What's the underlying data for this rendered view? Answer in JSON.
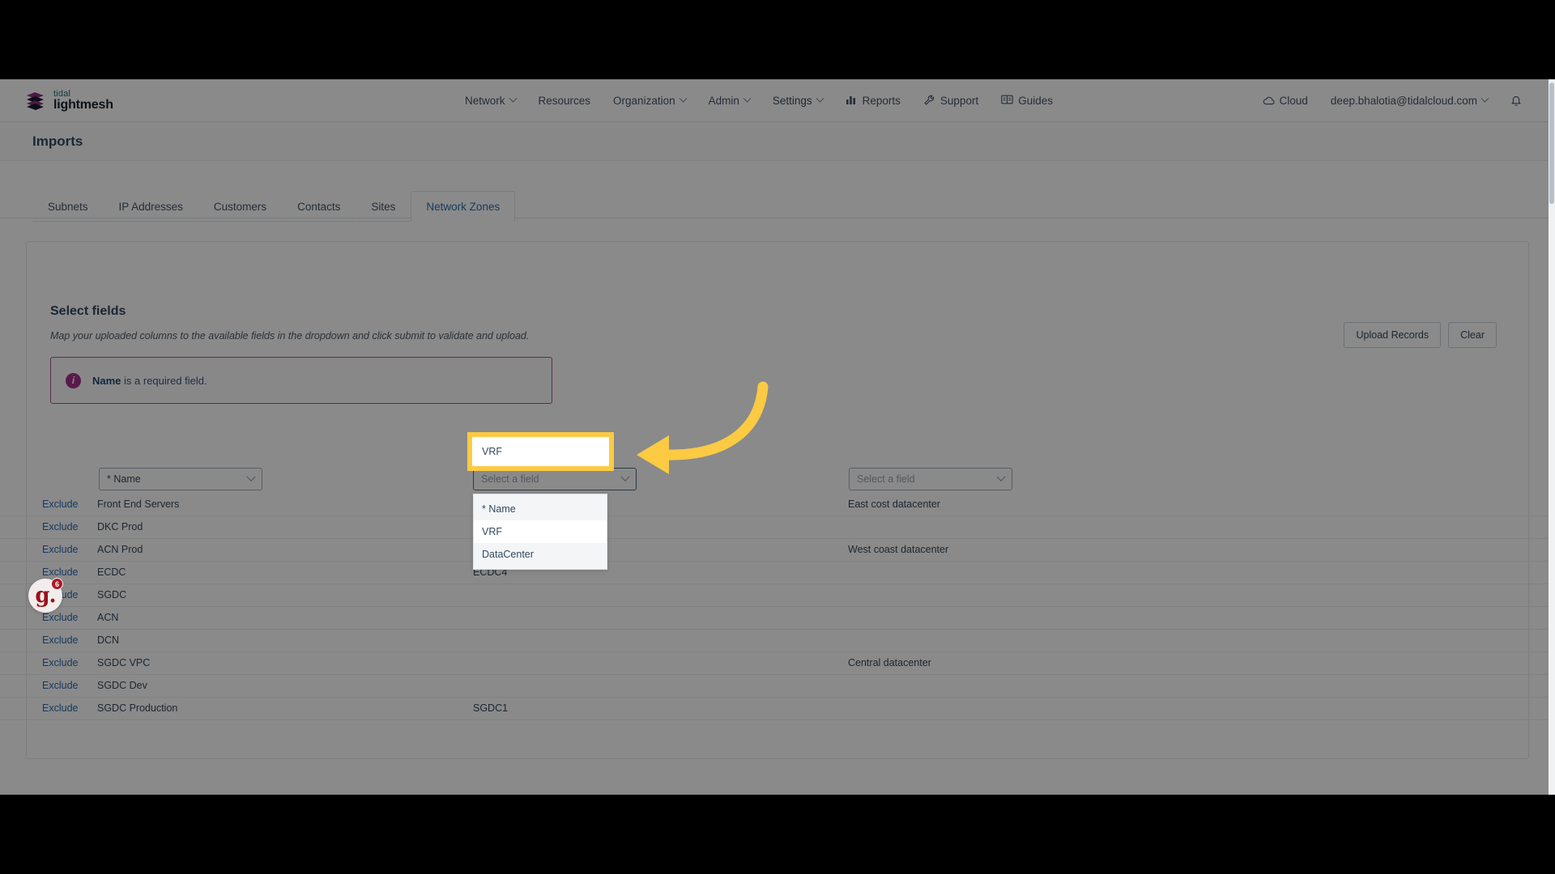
{
  "brand": {
    "line1": "tidal",
    "line2": "lightmesh"
  },
  "nav": {
    "items": [
      {
        "label": "Network",
        "caret": true,
        "icon": ""
      },
      {
        "label": "Resources",
        "caret": false,
        "icon": ""
      },
      {
        "label": "Organization",
        "caret": true,
        "icon": ""
      },
      {
        "label": "Admin",
        "caret": true,
        "icon": ""
      },
      {
        "label": "Settings",
        "caret": true,
        "icon": ""
      },
      {
        "label": "Reports",
        "caret": false,
        "icon": "chart-bar-icon"
      },
      {
        "label": "Support",
        "caret": false,
        "icon": "wrench-icon"
      },
      {
        "label": "Guides",
        "caret": false,
        "icon": "book-icon"
      }
    ],
    "right": {
      "cloud_label": "Cloud",
      "cloud_icon": "cloud-icon",
      "account_email": "deep.bhalotia@tidalcloud.com",
      "account_caret": true,
      "bell_icon": "bell-icon"
    }
  },
  "page": {
    "title": "Imports"
  },
  "tabs": [
    {
      "label": "Subnets",
      "active": false
    },
    {
      "label": "IP Addresses",
      "active": false
    },
    {
      "label": "Customers",
      "active": false
    },
    {
      "label": "Contacts",
      "active": false
    },
    {
      "label": "Sites",
      "active": false
    },
    {
      "label": "Network Zones",
      "active": true
    }
  ],
  "section": {
    "title": "Select fields",
    "subtitle": "Map your uploaded columns to the available fields in the dropdown and click submit to validate and upload."
  },
  "actions": {
    "upload_label": "Upload Records",
    "clear_label": "Clear"
  },
  "alert": {
    "icon": "info-icon",
    "icon_glyph": "i",
    "bold": "Name",
    "rest": " is a required field.",
    "border_color": "#a8528f"
  },
  "selects": {
    "col1": {
      "value": "* Name",
      "placeholder": "Select a field",
      "is_placeholder": false
    },
    "col2": {
      "value": "",
      "placeholder": "Select a field",
      "is_placeholder": true
    },
    "col3": {
      "value": "",
      "placeholder": "Select a field",
      "is_placeholder": true
    }
  },
  "dropdown": {
    "open": true,
    "options": [
      {
        "label": "* Name",
        "highlighted": false
      },
      {
        "label": "VRF",
        "highlighted": true
      },
      {
        "label": "DataCenter",
        "highlighted": false
      }
    ]
  },
  "callout": {
    "highlight_color": "#fcca43",
    "target_label": "VRF"
  },
  "table": {
    "exclude_label": "Exclude",
    "rows": [
      {
        "exclude": "Exclude",
        "name": "Front End Servers",
        "vrf": "",
        "datacenter": "East cost datacenter"
      },
      {
        "exclude": "Exclude",
        "name": "DKC Prod",
        "vrf": "",
        "datacenter": ""
      },
      {
        "exclude": "Exclude",
        "name": "ACN Prod",
        "vrf": "",
        "datacenter": "West coast datacenter"
      },
      {
        "exclude": "Exclude",
        "name": "ECDC",
        "vrf": "ECDC4",
        "datacenter": ""
      },
      {
        "exclude": "Exclude",
        "name": "SGDC",
        "vrf": "",
        "datacenter": ""
      },
      {
        "exclude": "Exclude",
        "name": "ACN",
        "vrf": "",
        "datacenter": ""
      },
      {
        "exclude": "Exclude",
        "name": "DCN",
        "vrf": "",
        "datacenter": ""
      },
      {
        "exclude": "Exclude",
        "name": "SGDC VPC",
        "vrf": "",
        "datacenter": "Central datacenter"
      },
      {
        "exclude": "Exclude",
        "name": "SGDC Dev",
        "vrf": "",
        "datacenter": ""
      },
      {
        "exclude": "Exclude",
        "name": "SGDC Production",
        "vrf": "SGDC1",
        "datacenter": ""
      }
    ]
  },
  "chat_widget": {
    "glyph": "g.",
    "badge_count": "6"
  }
}
